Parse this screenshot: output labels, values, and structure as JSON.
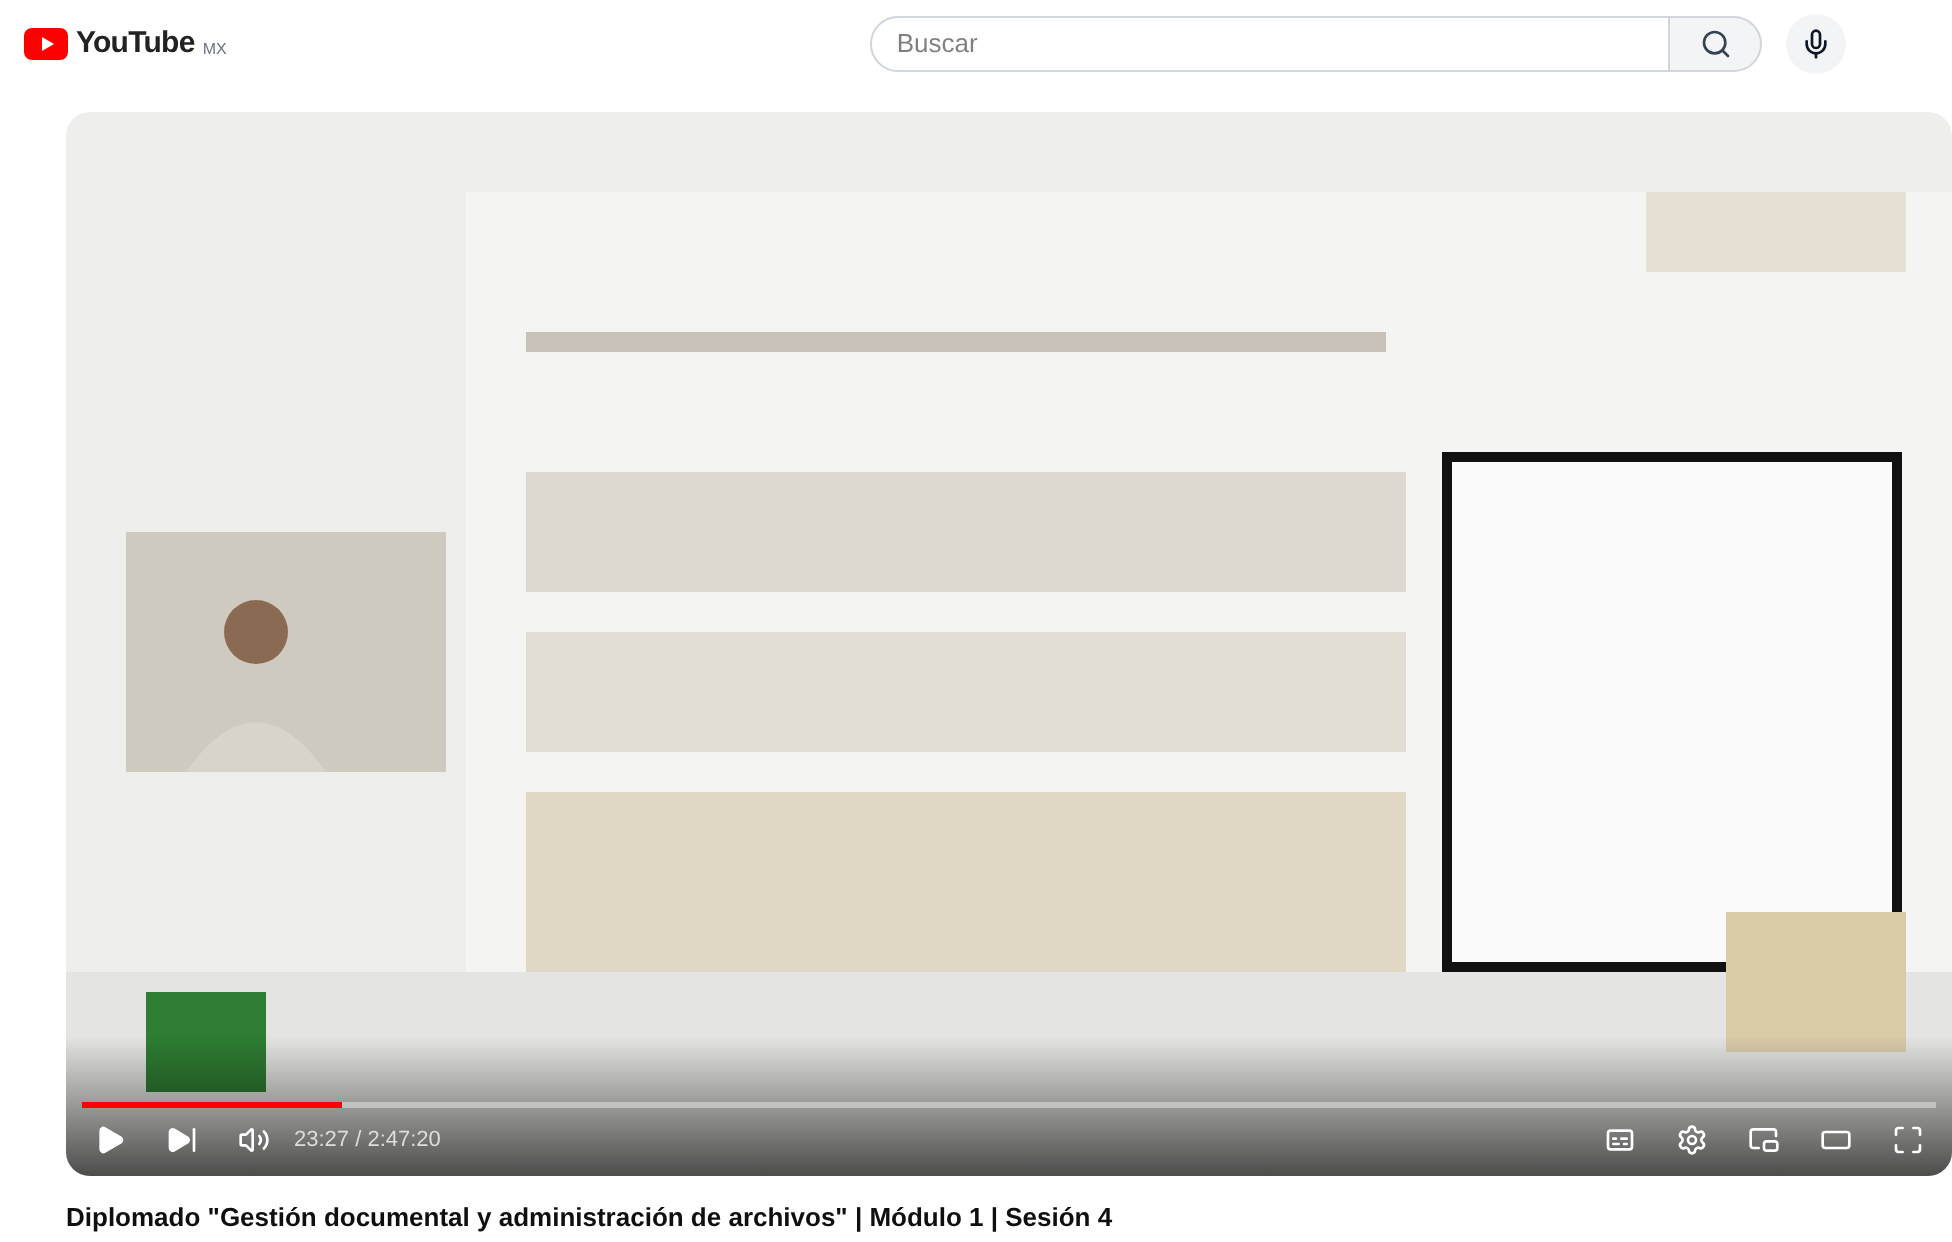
{
  "header": {
    "logo": "YouTube",
    "region": "MX",
    "search": {
      "placeholder": "Buscar"
    }
  },
  "player": {
    "progress": {
      "level": 0.14
    },
    "time": "23:27 / 2:47:20"
  },
  "video_title": "Diplomado \"Gestión documental y administración de archivos\" | Módulo 1 | Sesión 4"
}
